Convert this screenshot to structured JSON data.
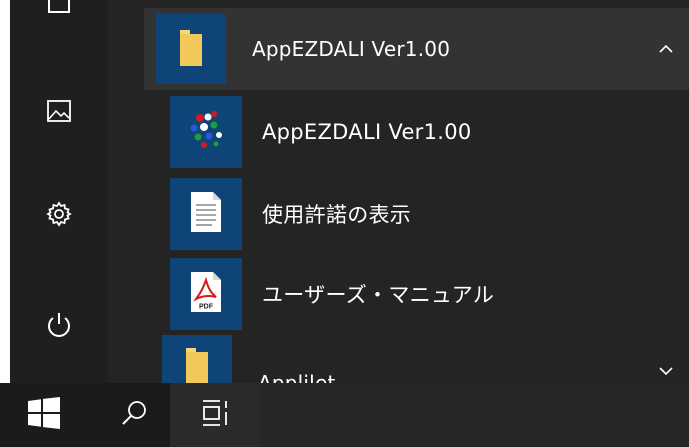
{
  "rail": {
    "icons": [
      "documents-icon",
      "pictures-icon",
      "settings-icon",
      "power-icon"
    ]
  },
  "expanded_group": {
    "label": "AppEZDALI Ver1.00",
    "icon": "folder-icon",
    "chevron": "chevron-up-icon"
  },
  "items": [
    {
      "label": "AppEZDALI Ver1.00",
      "icon": "appezdali-app-icon"
    },
    {
      "label": "使用許諾の表示",
      "icon": "text-document-icon"
    },
    {
      "label": "ユーザーズ・マニュアル",
      "icon": "pdf-document-icon"
    }
  ],
  "collapsed_group": {
    "label": "Applilet",
    "icon": "folder-icon",
    "chevron": "chevron-down-icon"
  },
  "taskbar": {
    "icons": [
      "windows-start-icon",
      "search-icon",
      "task-view-icon"
    ]
  },
  "colors": {
    "tile_blue": "#0e4477",
    "folder_yellow": "#f6d776",
    "expanded_group_bg": "#333333"
  }
}
